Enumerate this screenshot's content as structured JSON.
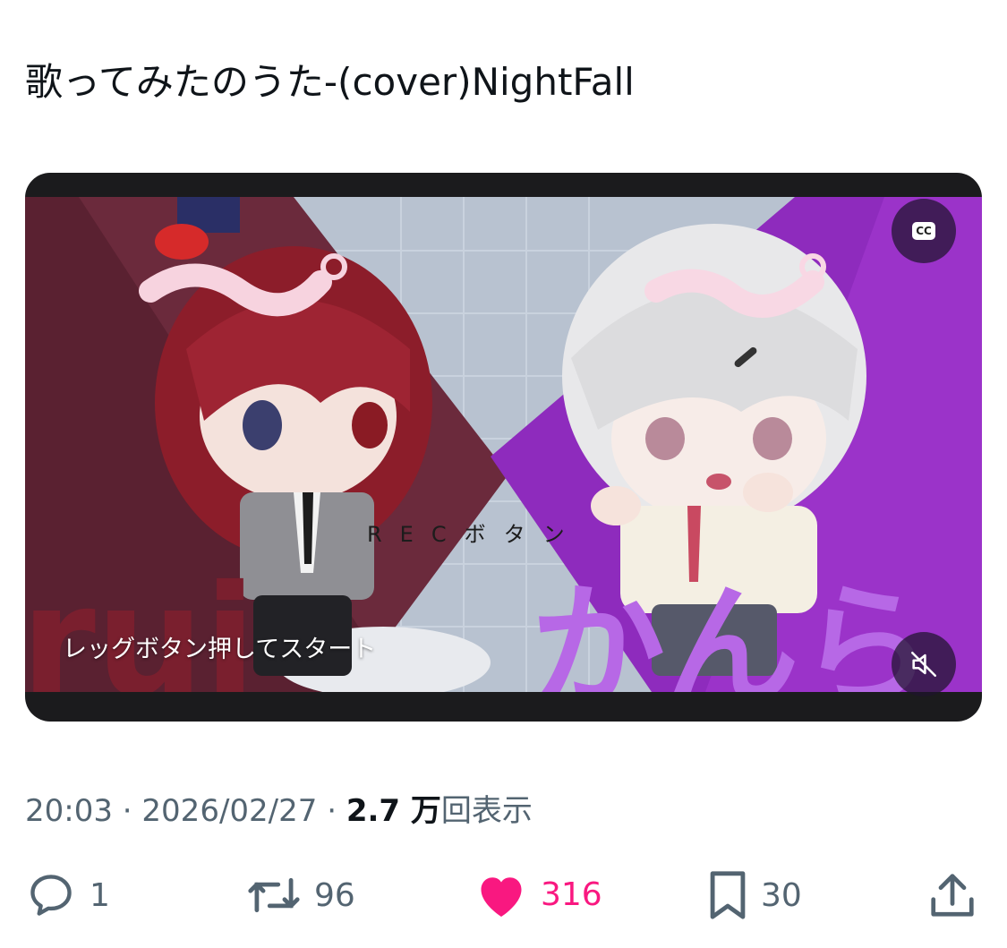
{
  "tweet": {
    "text": "歌ってみたのうた-(cover)NightFall"
  },
  "video": {
    "caption": "レッグボタン押してスタート",
    "overlay_text": "RECボタン",
    "left_name": "rui",
    "right_name": "かんら",
    "cc_label": "CC",
    "icons": {
      "captions": "cc-icon",
      "mute": "muted-speaker-icon"
    }
  },
  "meta": {
    "time": "20:03",
    "separator": " · ",
    "date": "2026/02/27",
    "views_count": "2.7 万",
    "views_suffix": "回表示"
  },
  "actions": {
    "reply": {
      "icon": "reply-bubble-icon",
      "count": "1"
    },
    "retweet": {
      "icon": "retweet-icon",
      "count": "96"
    },
    "like": {
      "icon": "heart-icon",
      "count": "316",
      "color": "#f91880"
    },
    "bookmark": {
      "icon": "bookmark-icon",
      "count": "30"
    },
    "share": {
      "icon": "share-icon"
    }
  },
  "colors": {
    "text_primary": "#0f1419",
    "text_secondary": "#536471",
    "like_active": "#f91880"
  }
}
